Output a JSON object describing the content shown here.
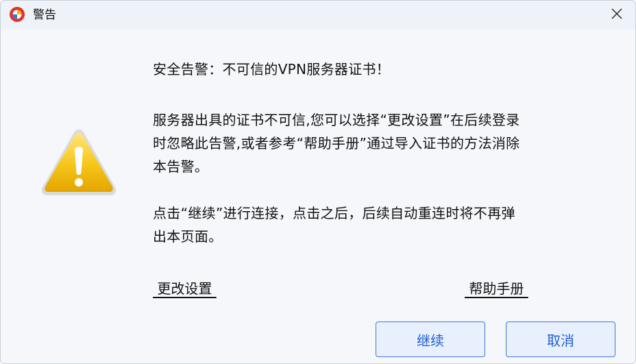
{
  "window": {
    "title": "警告",
    "app_icon": "app-logo-icon",
    "close_icon": "close-icon"
  },
  "message": {
    "icon": "warning-icon",
    "title": "安全告警：不可信的VPN服务器证书！",
    "paragraph1_line1": "服务器出具的证书不可信,您可以选择“更改设置”在后续登录",
    "paragraph1_line2": "时忽略此告警,或者参考“帮助手册”通过导入证书的方法消除",
    "paragraph1_line3": "本告警。",
    "paragraph2_line1": "点击“继续”进行连接，点击之后，后续自动重连时将不再弹",
    "paragraph2_line2": "出本页面。"
  },
  "links": {
    "change_settings": " 更改设置 ",
    "help_manual": " 帮助手册 "
  },
  "buttons": {
    "continue": "继续",
    "cancel": "取消"
  },
  "colors": {
    "accent": "#3d77d6",
    "button_bg": "#e9f0fd",
    "warning_yellow": "#f5c518"
  }
}
